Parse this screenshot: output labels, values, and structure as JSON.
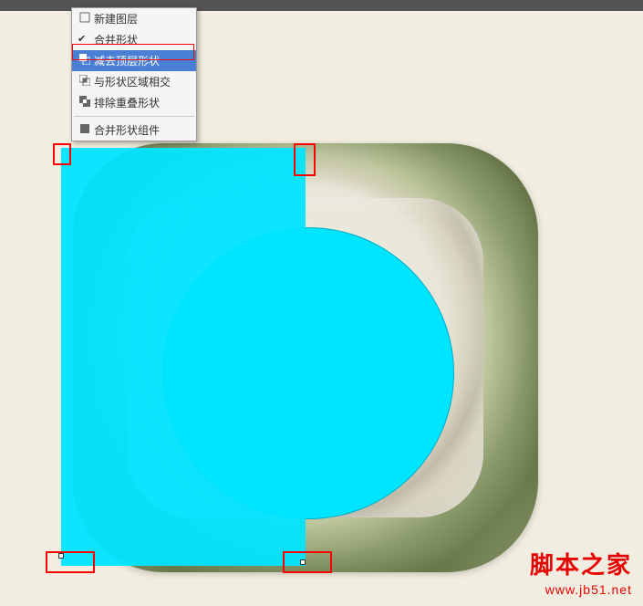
{
  "menu": {
    "items": [
      {
        "label": "新建图层",
        "icon": "new-layer-icon"
      },
      {
        "label": "合并形状",
        "icon": "merge-shapes-icon",
        "checked": true
      },
      {
        "label": "减去顶层形状",
        "icon": "subtract-front-icon",
        "highlighted": true
      },
      {
        "label": "与形状区域相交",
        "icon": "intersect-icon"
      },
      {
        "label": "排除重叠形状",
        "icon": "exclude-overlap-icon"
      }
    ],
    "footer": {
      "label": "合并形状组件",
      "icon": "merge-components-icon"
    }
  },
  "watermark": {
    "title": "脚本之家",
    "url": "www.jb51.net"
  },
  "colors": {
    "cyan": "#00e5ff",
    "highlight_red": "#ff0000",
    "menu_highlight": "#4a7fd6",
    "watermark": "#e60000"
  }
}
